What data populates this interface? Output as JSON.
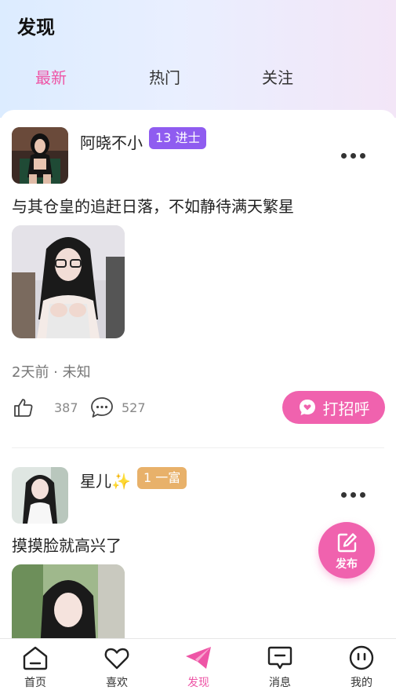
{
  "page": {
    "title": "发现"
  },
  "tabs": [
    {
      "label": "最新",
      "active": true
    },
    {
      "label": "热门",
      "active": false
    },
    {
      "label": "关注",
      "active": false
    }
  ],
  "posts": [
    {
      "username": "阿晓不小",
      "level_badge": "13 进士",
      "level_color": "#8f5cf0",
      "text": "与其仓皇的追赶日落，不如静待满天繁星",
      "meta": "2天前 · 未知",
      "likes": "387",
      "comments": "527",
      "greet_label": "打招呼"
    },
    {
      "username": "星儿",
      "username_emoji": "✨",
      "level_badge": "1 一富",
      "level_color": "#e8b16a",
      "text": "摸摸脸就高兴了"
    }
  ],
  "fab": {
    "label": "发布",
    "icon": "edit-icon"
  },
  "bottom_nav": [
    {
      "label": "首页",
      "icon": "home-icon",
      "active": false
    },
    {
      "label": "喜欢",
      "icon": "heart-icon",
      "active": false
    },
    {
      "label": "发现",
      "icon": "paper-plane-icon",
      "active": true
    },
    {
      "label": "消息",
      "icon": "message-icon",
      "active": false
    },
    {
      "label": "我的",
      "icon": "profile-face-icon",
      "active": false
    }
  ],
  "colors": {
    "accent": "#ee55a6",
    "button": "#f062ae"
  }
}
